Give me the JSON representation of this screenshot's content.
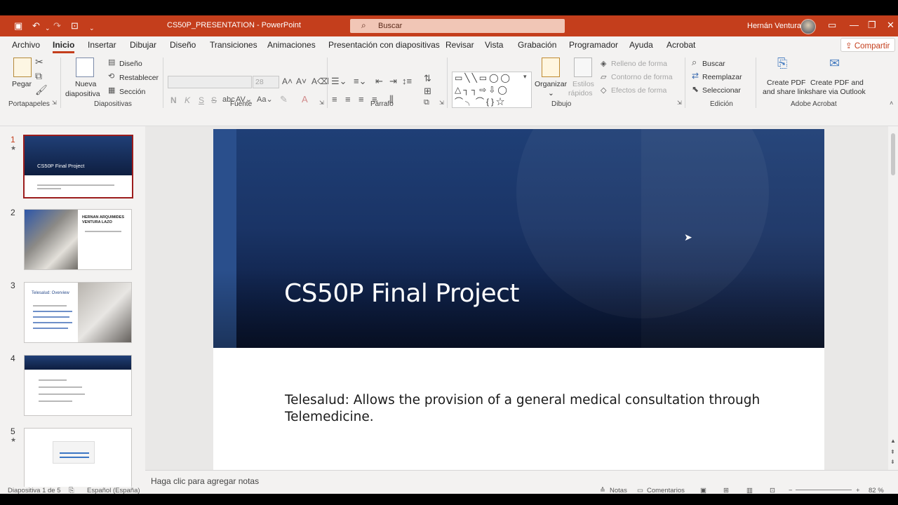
{
  "titlebar": {
    "doc_title": "CS50P_PRESENTATION  -  PowerPoint",
    "search_placeholder": "Buscar",
    "user_name": "Hernán Ventura"
  },
  "tabs": [
    "Archivo",
    "Inicio",
    "Insertar",
    "Dibujar",
    "Diseño",
    "Transiciones",
    "Animaciones",
    "Presentación con diapositivas",
    "Revisar",
    "Vista",
    "Grabación",
    "Programador",
    "Ayuda",
    "Acrobat"
  ],
  "active_tab": "Inicio",
  "share_label": "Compartir",
  "ribbon": {
    "portapapeles": {
      "label": "Portapapeles",
      "paste": "Pegar"
    },
    "diapositivas": {
      "label": "Diapositivas",
      "new_slide_1": "Nueva",
      "new_slide_2": "diapositiva",
      "layout": "Diseño",
      "reset": "Restablecer",
      "section": "Sección"
    },
    "fuente": {
      "label": "Fuente",
      "font_size": "28",
      "bold": "N",
      "italic": "K",
      "underline": "S",
      "strike": "S"
    },
    "parrafo": {
      "label": "Párrafo"
    },
    "dibujo": {
      "label": "Dibujo",
      "arrange": "Organizar",
      "quick_styles_1": "Estilos",
      "quick_styles_2": "rápidos",
      "fill": "Relleno de forma",
      "outline": "Contorno de forma",
      "effects": "Efectos de forma"
    },
    "edicion": {
      "label": "Edición",
      "find": "Buscar",
      "replace": "Reemplazar",
      "select": "Seleccionar"
    },
    "acrobat": {
      "label": "Adobe Acrobat",
      "create_1a": "Create PDF",
      "create_1b": "and share link",
      "create_2a": "Create PDF and",
      "create_2b": "share via Outlook"
    }
  },
  "thumbnails": [
    {
      "num": "1",
      "title": "CS50P Final Project",
      "starred": true
    },
    {
      "num": "2",
      "title": "HERNAN ARQUIMIDES VENTURA LAZO",
      "starred": false
    },
    {
      "num": "3",
      "title": "Telesalud: Overview",
      "starred": false
    },
    {
      "num": "4",
      "title": "",
      "starred": false
    },
    {
      "num": "5",
      "title": "",
      "starred": true
    }
  ],
  "slide": {
    "title": "CS50P Final Project",
    "subtitle": "Telesalud: Allows the provision of a general medical consultation through Telemedicine."
  },
  "notes_placeholder": "Haga clic para agregar notas",
  "status": {
    "slide_info": "Diapositiva 1 de 5",
    "language": "Español (España)",
    "notes": "Notas",
    "comments": "Comentarios",
    "zoom": "82 %"
  },
  "colors": {
    "accent": "#c43e1c",
    "slide_banner": "#1a3466"
  }
}
